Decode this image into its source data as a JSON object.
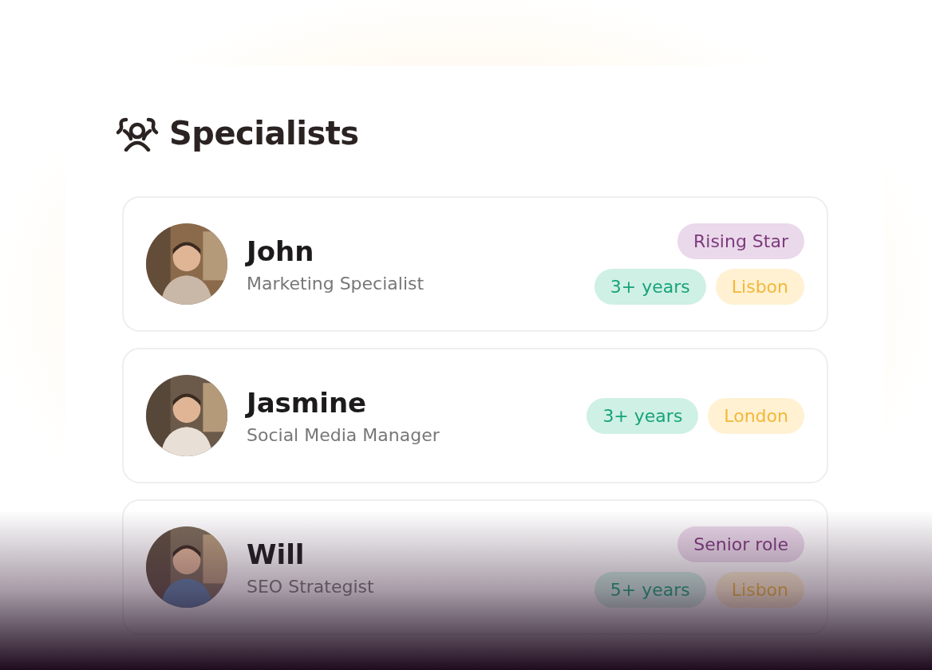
{
  "title": "Specialists",
  "specialists": [
    {
      "name": "John",
      "role": "Marketing Specialist",
      "tag_rows": [
        [
          {
            "label": "Rising Star",
            "kind": "highlight"
          }
        ],
        [
          {
            "label": "3+ years",
            "kind": "experience"
          },
          {
            "label": "Lisbon",
            "kind": "location"
          }
        ]
      ]
    },
    {
      "name": "Jasmine",
      "role": "Social Media Manager",
      "tag_rows": [
        [
          {
            "label": "3+ years",
            "kind": "experience"
          },
          {
            "label": "London",
            "kind": "location"
          }
        ]
      ]
    },
    {
      "name": "Will",
      "role": "SEO Strategist",
      "tag_rows": [
        [
          {
            "label": "Senior role",
            "kind": "highlight"
          }
        ],
        [
          {
            "label": "5+ years",
            "kind": "experience"
          },
          {
            "label": "Lisbon",
            "kind": "location"
          }
        ]
      ]
    }
  ]
}
